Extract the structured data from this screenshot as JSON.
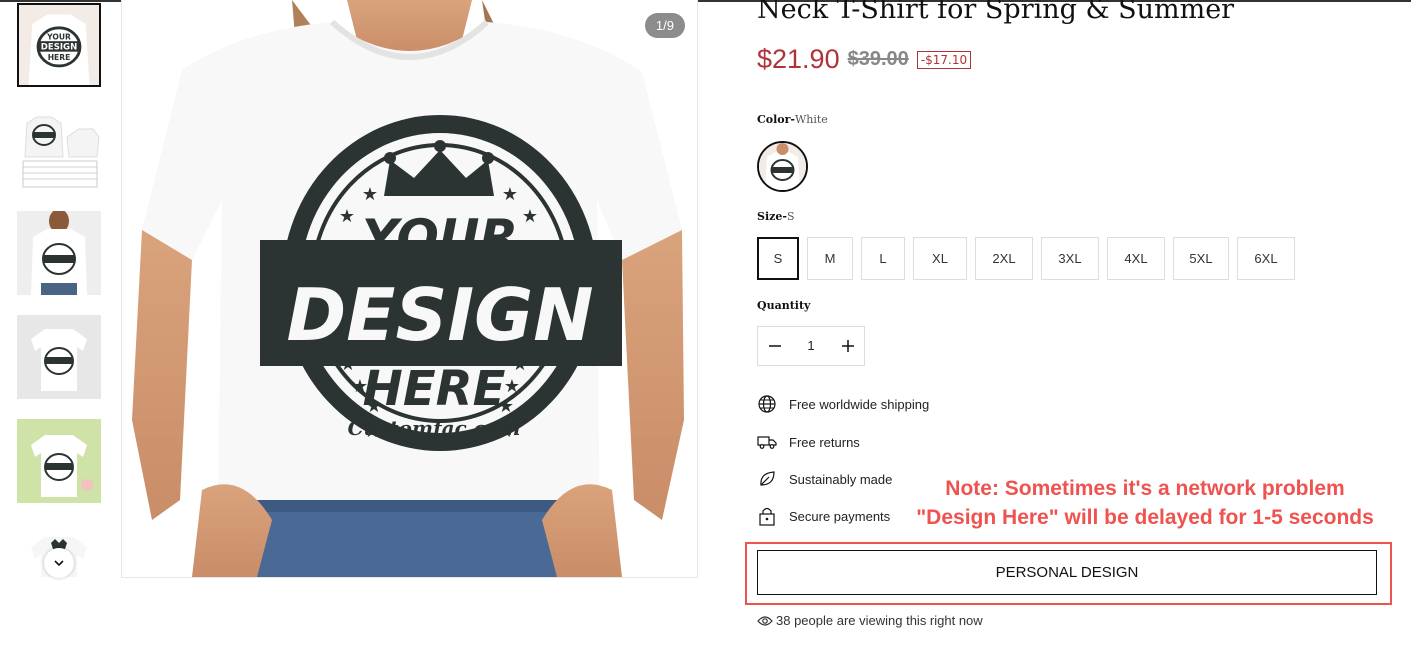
{
  "product": {
    "title": "Neck T-Shirt for Spring & Summer",
    "price": "$21.90",
    "compare_price": "$39.00",
    "save_badge": "-$17.10",
    "image_counter": "1/9",
    "design_text": {
      "line1": "YOUR",
      "line2": "DESIGN",
      "line3": "HERE",
      "brand": "Customfac.com"
    }
  },
  "options": {
    "color_label": "Color-",
    "color_value": "White",
    "size_label": "Size-",
    "size_value": "S",
    "sizes": [
      "S",
      "M",
      "L",
      "XL",
      "2XL",
      "3XL",
      "4XL",
      "5XL",
      "6XL"
    ],
    "selected_size": "S",
    "quantity_label": "Quantity",
    "quantity": "1"
  },
  "features": [
    {
      "icon": "globe-icon",
      "label": "Free worldwide shipping"
    },
    {
      "icon": "truck-icon",
      "label": "Free returns"
    },
    {
      "icon": "leaf-icon",
      "label": "Sustainably made"
    },
    {
      "icon": "lock-icon",
      "label": "Secure payments"
    }
  ],
  "note": {
    "line1": "Note: Sometimes it's a network problem",
    "line2": "\"Design Here\" will be delayed for 1-5 seconds"
  },
  "personal_design_button": "PERSONAL DESIGN",
  "viewers_text": "38 people are viewing this right now",
  "colors": {
    "price_red": "#b1333a",
    "note_red": "#ef5350",
    "shirt_print": "#2b3333"
  }
}
